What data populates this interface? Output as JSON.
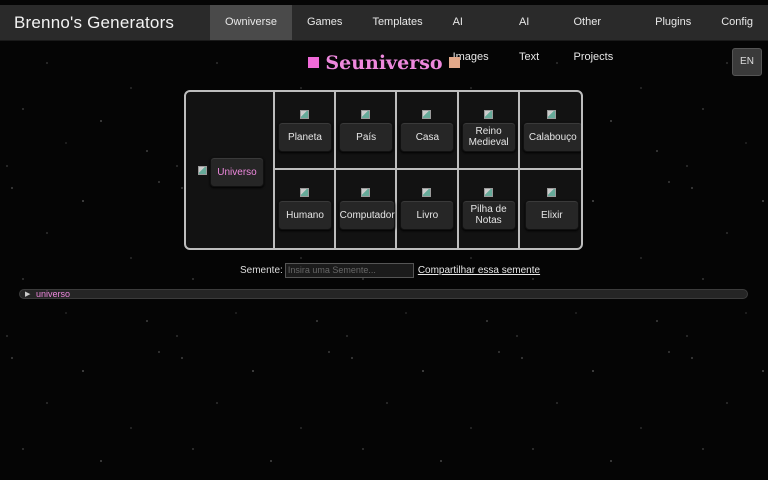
{
  "header": {
    "brand": "Brenno's Generators",
    "nav": [
      {
        "label": "Owniverse",
        "active": true
      },
      {
        "label": "Games"
      },
      {
        "label": "Templates"
      },
      {
        "label": "AI Images"
      },
      {
        "label": "AI Text"
      },
      {
        "label": "Other Projects"
      },
      {
        "label": "Plugins"
      },
      {
        "label": "Config"
      }
    ]
  },
  "language_button": "EN",
  "title": "Seuniverso",
  "colors": {
    "accent_pink": "#ee88dd",
    "square_left": "#f06ad8",
    "square_right": "#e3a98a"
  },
  "generators": {
    "main": "Universo",
    "row1": [
      "Planeta",
      "País",
      "Casa",
      "Reino Medieval",
      "Calabouço"
    ],
    "row2": [
      "Humano",
      "Computador",
      "Livro",
      "Pilha de Notas",
      "Elixir"
    ]
  },
  "seed": {
    "label": "Semente:",
    "placeholder": "Insira uma Semente...",
    "share_link": "Compartilhar essa semente"
  },
  "tree": {
    "root_label": "universo",
    "toggle_icon": "triangle-right-icon"
  }
}
